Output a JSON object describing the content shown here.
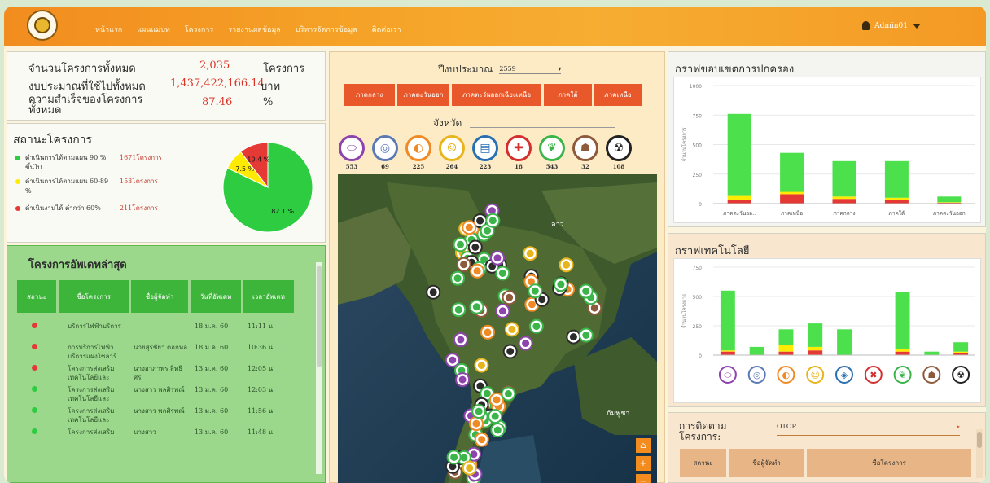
{
  "nav": {
    "items": [
      "หน้าแรก",
      "แผนแม่บท",
      "โครงการ",
      "รายงานผลข้อมูล",
      "บริหารจัดการข้อมูล",
      "ติดต่อเรา"
    ],
    "user": "Admin01"
  },
  "summary": {
    "rows": [
      {
        "label": "จำนวนโครงการทั้งหมด",
        "value": "2,035",
        "unit": "โครงการ"
      },
      {
        "label": "งบประมาณที่ใช้ไปทั้งหมด",
        "value": "1,437,422,166.14",
        "unit": "บาท"
      },
      {
        "label": "ความสำเร็จของโครงการทั้งหมด",
        "value": "87.46",
        "unit": "%"
      }
    ]
  },
  "status": {
    "title": "สถานะโครงการ",
    "items": [
      {
        "text": "ดำเนินการได้ตามแผน 90 % ขึ้นไป",
        "count": "1671โครงการ",
        "color": "#2ecc40"
      },
      {
        "text": "ดำเนินการได้ตามแผน 60-89 %",
        "count": "153โครงการ",
        "color": "#ffeb00"
      },
      {
        "text": "ดำเนินงานได้ ต่ำกว่า 60%",
        "count": "211โครงการ",
        "color": "#e53935"
      }
    ],
    "chart_data": {
      "type": "pie",
      "labels": [
        "82.1 %",
        "7.5 %",
        "10.4 %"
      ],
      "values": [
        82.1,
        7.5,
        10.4
      ],
      "colors": [
        "#2ecc40",
        "#ffeb00",
        "#e53935"
      ]
    }
  },
  "updates": {
    "title": "โครงการอัพเดทล่าสุด",
    "headers": [
      "สถานะ",
      "ชื่อโครงการ",
      "ชื่อผู้จัดทำ",
      "วันที่อัพเดท",
      "เวลาอัพเดท"
    ],
    "rows": [
      {
        "status": "#e53935",
        "name": "บริการไฟฟ้าบริการ",
        "author": "",
        "date": "18 ม.ค. 60",
        "time": "11:11 น."
      },
      {
        "status": "#e53935",
        "name": "การบริการไฟฟ้าบริการแผงโซลาร์",
        "author": "นายสุรชัยา ดอกหล",
        "date": "18 ม.ค. 60",
        "time": "10:36 น."
      },
      {
        "status": "#e53935",
        "name": "โครงการส่งเสริมเทคโนโลยีและ",
        "author": "นางอาภาพร สิทธิศร",
        "date": "13 ม.ค. 60",
        "time": "12:05 น."
      },
      {
        "status": "#2ecc40",
        "name": "โครงการส่งเสริมเทคโนโลยีและ",
        "author": "นางสาว พลศิรพณ์",
        "date": "13 ม.ค. 60",
        "time": "12:03 น."
      },
      {
        "status": "#2ecc40",
        "name": "โครงการส่งเสริมเทคโนโลยีและ",
        "author": "นางสาว พลศิรพณ์",
        "date": "13 ม.ค. 60",
        "time": "11:56 น."
      },
      {
        "status": "#2ecc40",
        "name": "โครงการส่งเสริม",
        "author": "นางสาว",
        "date": "13 ม.ค. 60",
        "time": "11:48 น."
      }
    ]
  },
  "map": {
    "year_label": "ปีงบประมาณ",
    "year": "2559",
    "regions": [
      "ภาคกลาง",
      "ภาคตะวันออก",
      "ภาคตะวันออกเฉียงเหนือ",
      "ภาคใต้",
      "ภาคเหนือ"
    ],
    "province_label": "จังหวัด",
    "labels": {
      "laos": "ลาว",
      "cambodia": "กัมพูชา"
    },
    "categories": [
      {
        "icon": "⬭",
        "color": "#8e44ad",
        "count": "553"
      },
      {
        "icon": "◎",
        "color": "#5b7ab5",
        "count": "69"
      },
      {
        "icon": "◐",
        "color": "#f08a24",
        "count": "225"
      },
      {
        "icon": "☺",
        "color": "#e8b41c",
        "count": "264"
      },
      {
        "icon": "▤",
        "color": "#2a6fb0",
        "count": "223"
      },
      {
        "icon": "✚",
        "color": "#d32f2f",
        "count": "18"
      },
      {
        "icon": "❦",
        "color": "#3bb54a",
        "count": "543"
      },
      {
        "icon": "☗",
        "color": "#8d5a3b",
        "count": "32"
      },
      {
        "icon": "☢",
        "color": "#222222",
        "count": "108"
      }
    ]
  },
  "region_chart": {
    "title": "กราฟขอบเขตการปกครอง",
    "chart_data": {
      "type": "bar",
      "categories": [
        "ภาคตะวันออ..",
        "ภาคเหนือ",
        "ภาคกลาง",
        "ภาคใต้",
        "ภาคตะวันออก"
      ],
      "ylabel": "จำนวนโครงการ",
      "ylim": [
        0,
        1000
      ],
      "yticks": [
        "1000",
        "750",
        "500",
        "250",
        "0"
      ],
      "series": [
        {
          "color": "#e53935",
          "values": [
            30,
            80,
            40,
            30,
            8
          ]
        },
        {
          "color": "#ffeb00",
          "values": [
            35,
            20,
            20,
            20,
            4
          ]
        },
        {
          "color": "#4ce04c",
          "values": [
            695,
            330,
            300,
            310,
            48
          ]
        }
      ]
    }
  },
  "tech_chart": {
    "title": "กราฟเทคโนโลยี",
    "chart_data": {
      "type": "bar",
      "ylabel": "จำนวนโครงการ",
      "ylim": [
        0,
        750
      ],
      "yticks": [
        "750",
        "500",
        "250",
        "0"
      ],
      "icons": [
        {
          "icon": "⬭",
          "color": "#8e44ad"
        },
        {
          "icon": "◎",
          "color": "#5b7ab5"
        },
        {
          "icon": "◐",
          "color": "#f08a24"
        },
        {
          "icon": "☺",
          "color": "#e8b41c"
        },
        {
          "icon": "◈",
          "color": "#2a6fb0"
        },
        {
          "icon": "✖",
          "color": "#d32f2f"
        },
        {
          "icon": "❦",
          "color": "#3bb54a"
        },
        {
          "icon": "☗",
          "color": "#8d5a3b"
        },
        {
          "icon": "☢",
          "color": "#222222"
        }
      ],
      "series": [
        {
          "color": "#e53935",
          "values": [
            30,
            0,
            30,
            40,
            0,
            0,
            30,
            0,
            20
          ]
        },
        {
          "color": "#ffeb00",
          "values": [
            10,
            0,
            60,
            30,
            0,
            0,
            20,
            0,
            10
          ]
        },
        {
          "color": "#4ce04c",
          "values": [
            510,
            70,
            130,
            200,
            220,
            0,
            490,
            30,
            80
          ]
        }
      ]
    }
  },
  "follow": {
    "title": "การติดตามโครงการ:",
    "select": "OTOP",
    "headers": [
      "สถานะ",
      "ชื่อผู้จัดทำ",
      "ชื่อโครงการ"
    ]
  }
}
